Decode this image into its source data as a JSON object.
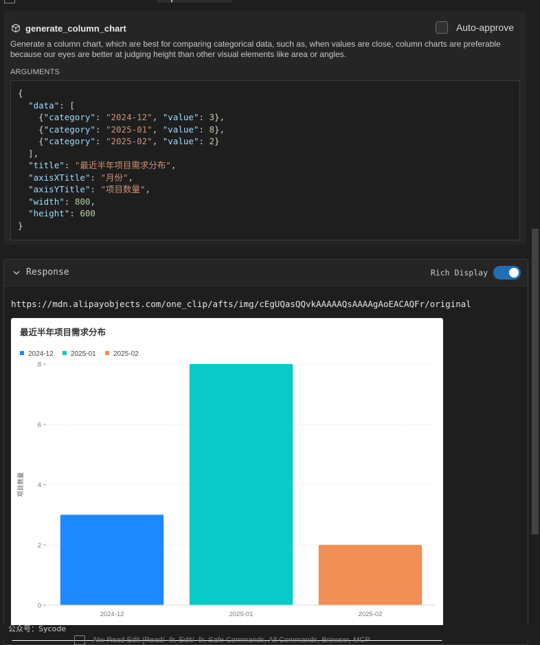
{
  "tool": {
    "name": "generate_column_chart",
    "auto_approve_label": "Auto-approve",
    "auto_approve_checked": false,
    "description": "Generate a column chart, which are best for comparing categorical data, such as, when values are close, column charts are preferable because our eyes are better at judging height than other visual elements like area or angles.",
    "arguments_label": "ARGUMENTS"
  },
  "arguments": {
    "data": [
      {
        "category": "2024-12",
        "value": 3
      },
      {
        "category": "2025-01",
        "value": 8
      },
      {
        "category": "2025-02",
        "value": 2
      }
    ],
    "title": "最近半年项目需求分布",
    "axisXTitle": "月份",
    "axisYTitle": "项目数量",
    "width": 800,
    "height": 600
  },
  "response": {
    "title": "Response",
    "rich_display_label": "Rich Display",
    "rich_display_on": true,
    "url": "https://mdn.alipayobjects.com/one_clip/afts/img/cEgUQasQQvkAAAAAQsAAAAgAoEACAQFr/original"
  },
  "chart_data": {
    "type": "bar",
    "title": "最近半年项目需求分布",
    "categories": [
      "2024-12",
      "2025-01",
      "2025-02"
    ],
    "values": [
      3,
      8,
      2
    ],
    "colors": [
      "#1e88ff",
      "#0acac8",
      "#f08e55"
    ],
    "legend": [
      "2024-12",
      "2025-01",
      "2025-02"
    ],
    "legend_position": "top-left",
    "xlabel": "",
    "ylabel": "项目数量",
    "ylim": [
      0,
      8
    ],
    "yticks": [
      0,
      2,
      4,
      6,
      8
    ],
    "grid": true
  },
  "footer": {
    "watermark": "公众号：Sycode",
    "ghost_text": "Alw  Read  Edit  (Read/ -llr, Edit/ -llr, Safe Commands, All Commands, Browser, MCP"
  }
}
